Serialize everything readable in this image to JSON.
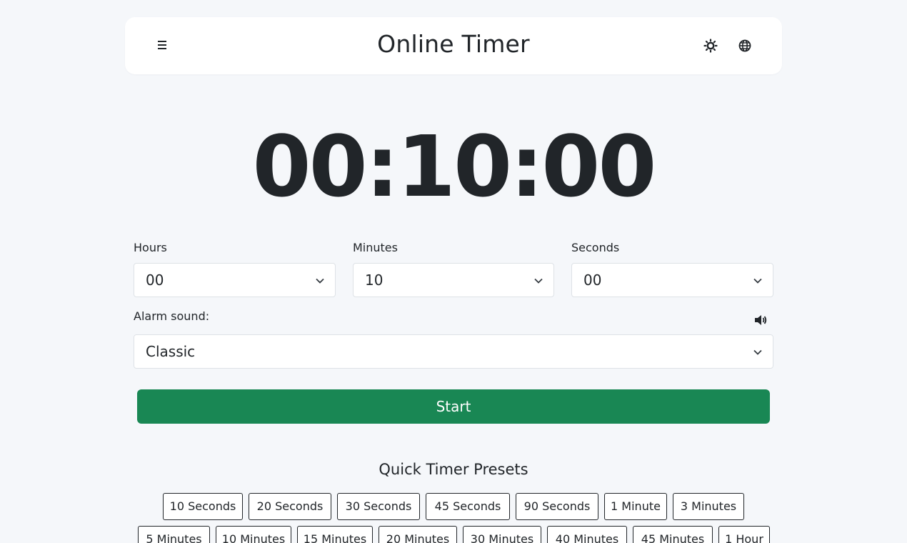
{
  "header": {
    "title": "Online Timer",
    "menu_icon": "hamburger-menu-icon",
    "theme_icon": "sun-icon",
    "language_icon": "globe-icon"
  },
  "timer": {
    "display": "00:10:00"
  },
  "fields": {
    "hours": {
      "label": "Hours",
      "value": "00"
    },
    "minutes": {
      "label": "Minutes",
      "value": "10"
    },
    "seconds": {
      "label": "Seconds",
      "value": "00"
    },
    "alarm": {
      "label": "Alarm sound:",
      "value": "Classic",
      "volume_icon": "volume-icon"
    }
  },
  "start_button": {
    "label": "Start",
    "color": "#198754"
  },
  "presets": {
    "title": "Quick Timer Presets",
    "row1": [
      "10 Seconds",
      "20 Seconds",
      "30 Seconds",
      "45 Seconds",
      "90 Seconds",
      "1 Minute",
      "3 Minutes"
    ],
    "row2": [
      "5 Minutes",
      "10 Minutes",
      "15 Minutes",
      "20 Minutes",
      "30 Minutes",
      "40 Minutes",
      "45 Minutes",
      "1 Hour"
    ]
  }
}
